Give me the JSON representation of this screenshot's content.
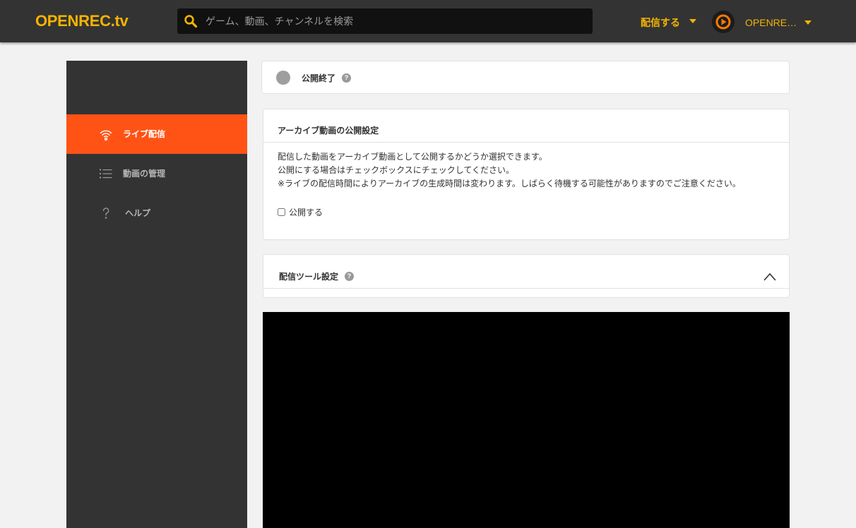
{
  "header": {
    "logo_text": "OPENREC.tv",
    "search": {
      "icon": "search-icon",
      "placeholder": "ゲーム、動画、チャンネルを検索",
      "value": ""
    },
    "broadcast_menu": {
      "label": "配信する",
      "icon": "caret-down-icon"
    },
    "user_menu": {
      "name": "OPENRE…",
      "avatar": "openrec-avatar",
      "icon": "caret-down-icon"
    }
  },
  "sidebar": {
    "items": [
      {
        "label": "ライブ配信",
        "icon": "broadcast-icon",
        "active": true
      },
      {
        "label": "動画の管理",
        "icon": "list-icon",
        "active": false
      },
      {
        "label": "ヘルプ",
        "icon": "question-icon",
        "active": false
      }
    ]
  },
  "publish_status": {
    "label": "公開終了",
    "icon": "status-dot",
    "help_icon": "help-icon"
  },
  "archive_settings": {
    "title": "アーカイブ動画の公開設定",
    "description": [
      "配信した動画をアーカイブ動画として公開するかどうか選択できます。",
      "公開にする場合はチェックボックスにチェックしてください。",
      "※ライブの配信時間によりアーカイブの生成時間は変わります。しばらく待機する可能性がありますのでご注意ください。"
    ],
    "publish_checkbox": {
      "label": "公開する",
      "checked": false
    }
  },
  "tool_settings": {
    "title": "配信ツール設定",
    "help_icon": "help-icon",
    "toggle_icon": "chevron-up-icon",
    "expanded": true
  },
  "colors": {
    "brand": "#f5b400",
    "accent": "#ff5316",
    "header_bg": "#333333",
    "sidebar_bg": "#333333",
    "page_bg": "#f2f2f2",
    "status_dot": "#9e9e9e",
    "video_bg": "#000000"
  }
}
